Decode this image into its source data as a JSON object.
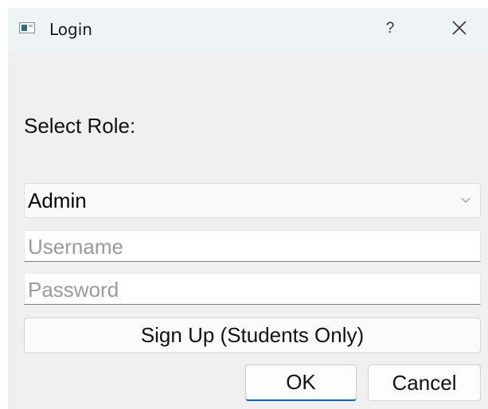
{
  "window": {
    "title": "Login",
    "icon": "app-window-icon",
    "help_label": "?",
    "close_icon": "close-icon"
  },
  "form": {
    "role_label": "Select Role:",
    "role_select": {
      "selected": "Admin",
      "icon": "chevron-down-icon"
    },
    "username": {
      "value": "",
      "placeholder": "Username"
    },
    "password": {
      "value": "",
      "placeholder": "Password"
    },
    "signup_label": "Sign Up (Students Only)",
    "ok_label": "OK",
    "cancel_label": "Cancel"
  },
  "colors": {
    "titlebar": "#eef4f6",
    "window_bg": "#f0f0f0",
    "accent": "#0067c0",
    "placeholder_text": "#9a9a9a"
  }
}
